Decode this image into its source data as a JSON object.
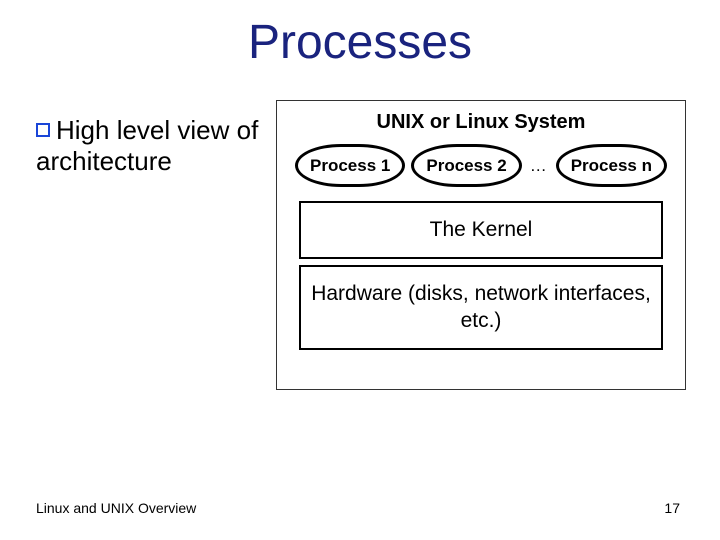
{
  "title": "Processes",
  "bullet": "High level view of architecture",
  "diagram": {
    "system_label": "UNIX or Linux System",
    "process1": "Process 1",
    "process2": "Process 2",
    "ellipsis": "…",
    "processN": "Process n",
    "kernel": "The Kernel",
    "hardware": "Hardware (disks, network interfaces, etc.)"
  },
  "footer": {
    "left": "Linux and UNIX Overview",
    "page": "17"
  }
}
